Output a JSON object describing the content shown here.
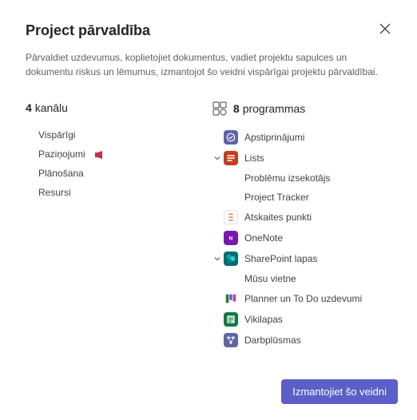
{
  "title": "Project pārvaldība",
  "description": "Pārvaldiet uzdevumus, koplietojiet dokumentus, vadiet projektu sapulces un dokumentu riskus un lēmumus, izmantojot šo veidni vispārīgai projektu pārvaldībai.",
  "channels": {
    "count": "4",
    "label": "kanālu",
    "items": [
      "Vispārīgi",
      "Paziņojumi",
      "Plānošana",
      "Resursi"
    ]
  },
  "apps": {
    "count": "8",
    "label": "programmas",
    "items": {
      "approvals": "Apstiprinājumi",
      "lists": "Lists",
      "issueTracker": "Problēmu izsekotājs",
      "projectTracker": "Project Tracker",
      "milestones": "Atskaites punkti",
      "onenote": "OneNote",
      "sharepoint": "SharePoint lapas",
      "oursite": "Mūsu vietne",
      "planner": "Planner un To Do uzdevumi",
      "wiki": "Vikilapas",
      "workflows": "Darbplūsmas"
    }
  },
  "button": "Izmantojiet šo veidni"
}
